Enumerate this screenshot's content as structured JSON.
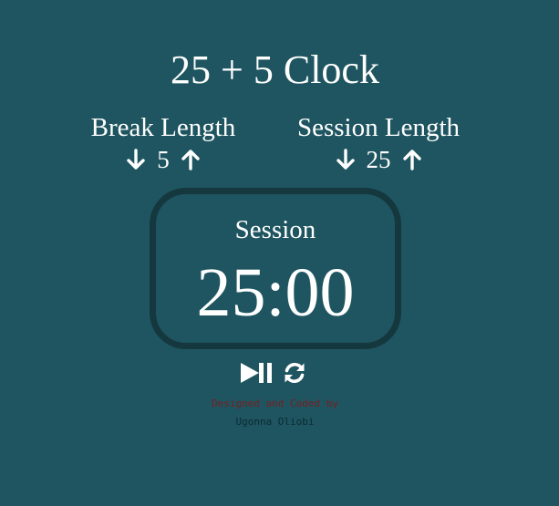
{
  "app": {
    "title": "25 + 5 Clock"
  },
  "break_length": {
    "label": "Break Length",
    "value": "5",
    "decrement_icon": "arrow-down-icon",
    "increment_icon": "arrow-up-icon"
  },
  "session_length": {
    "label": "Session Length",
    "value": "25",
    "decrement_icon": "arrow-down-icon",
    "increment_icon": "arrow-up-icon"
  },
  "timer": {
    "label": "Session",
    "time_left": "25:00"
  },
  "actions": {
    "start_stop_icon": "play-pause-icon",
    "reset_icon": "refresh-icon"
  },
  "footer": {
    "line1": "Designed and Coded by",
    "line2": "Ugonna Oliobi"
  },
  "colors": {
    "background": "#1e5560",
    "timer_border": "#15383f",
    "text": "#ffffff",
    "credit_line1": "#7a1f1f",
    "credit_line2": "#0c2a33"
  }
}
